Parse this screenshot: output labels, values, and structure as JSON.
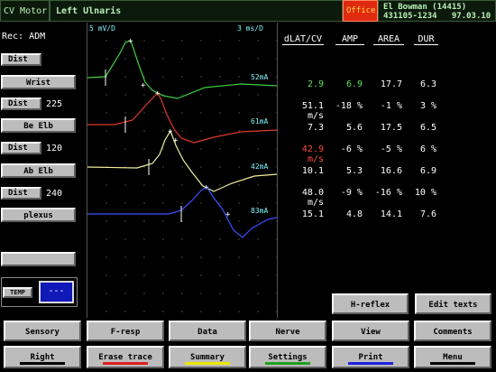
{
  "header": {
    "title": "CV Motor",
    "nerve": "Left Ulnaris",
    "office": "Office",
    "patient_name": "El Bowman (14415)",
    "patient_id": "431105-1234",
    "date": "97.03.10"
  },
  "recording": "Rec: ADM",
  "sites": [
    {
      "dist_label": "Dist",
      "site_label": "Wrist",
      "dist_value": "225"
    },
    {
      "dist_label": "Dist",
      "site_label": "Be Elb",
      "dist_value": "120"
    },
    {
      "dist_label": "Dist",
      "site_label": "Ab Elb",
      "dist_value": "240"
    },
    {
      "site_label": "plexus"
    }
  ],
  "temp": {
    "label": "TEMP",
    "value": "---"
  },
  "trace": {
    "gain": "5 mV/D",
    "sweep": "3 ms/D",
    "stimuli": [
      "52mA",
      "61mA",
      "42mA",
      "83mA"
    ],
    "colors": [
      "#3fd03f",
      "#e03a2a",
      "#f0f0a0",
      "#3a50ff"
    ]
  },
  "table": {
    "headers": [
      "dLAT/CV",
      "AMP",
      "AREA",
      "DUR"
    ],
    "rows": [
      {
        "dlat": "2.9",
        "amp": "6.9",
        "area": "17.7",
        "dur": "6.3",
        "color": "#5ee05e"
      },
      {
        "dlat": "51.1 m/s",
        "amp": "-18 %",
        "area": "-1 %",
        "dur": "3 %",
        "color": "#ffffff"
      },
      {
        "dlat": "7.3",
        "amp": "5.6",
        "area": "17.5",
        "dur": "6.5",
        "color": "#ffffff"
      },
      {
        "dlat": "42.9 m/s",
        "amp": "-6 %",
        "area": "-5 %",
        "dur": "6 %",
        "color": "#ff4a3a"
      },
      {
        "dlat": "10.1",
        "amp": "5.3",
        "area": "16.6",
        "dur": "6.9",
        "color": "#ffffff"
      },
      {
        "dlat": "48.0 m/s",
        "amp": "-9 %",
        "area": "-16 %",
        "dur": "10 %",
        "color": "#ffffff"
      },
      {
        "dlat": "15.1",
        "amp": "4.8",
        "area": "14.1",
        "dur": "7.6",
        "color": "#ffffff"
      }
    ]
  },
  "actions": {
    "hreflex": "H-reflex",
    "edit_texts": "Edit texts"
  },
  "bottom_row1": [
    "Sensory",
    "F-resp",
    "Data",
    "Nerve",
    "View",
    "Comments"
  ],
  "bottom_row2": [
    {
      "label": "Right",
      "underline": "#000000"
    },
    {
      "label": "Erase trace",
      "underline": "#e02020"
    },
    {
      "label": "Summary",
      "underline": "#e8e800"
    },
    {
      "label": "Settings",
      "underline": "#20a020"
    },
    {
      "label": "Print",
      "underline": "#2020e0"
    },
    {
      "label": "Menu",
      "underline": "#000000"
    }
  ]
}
